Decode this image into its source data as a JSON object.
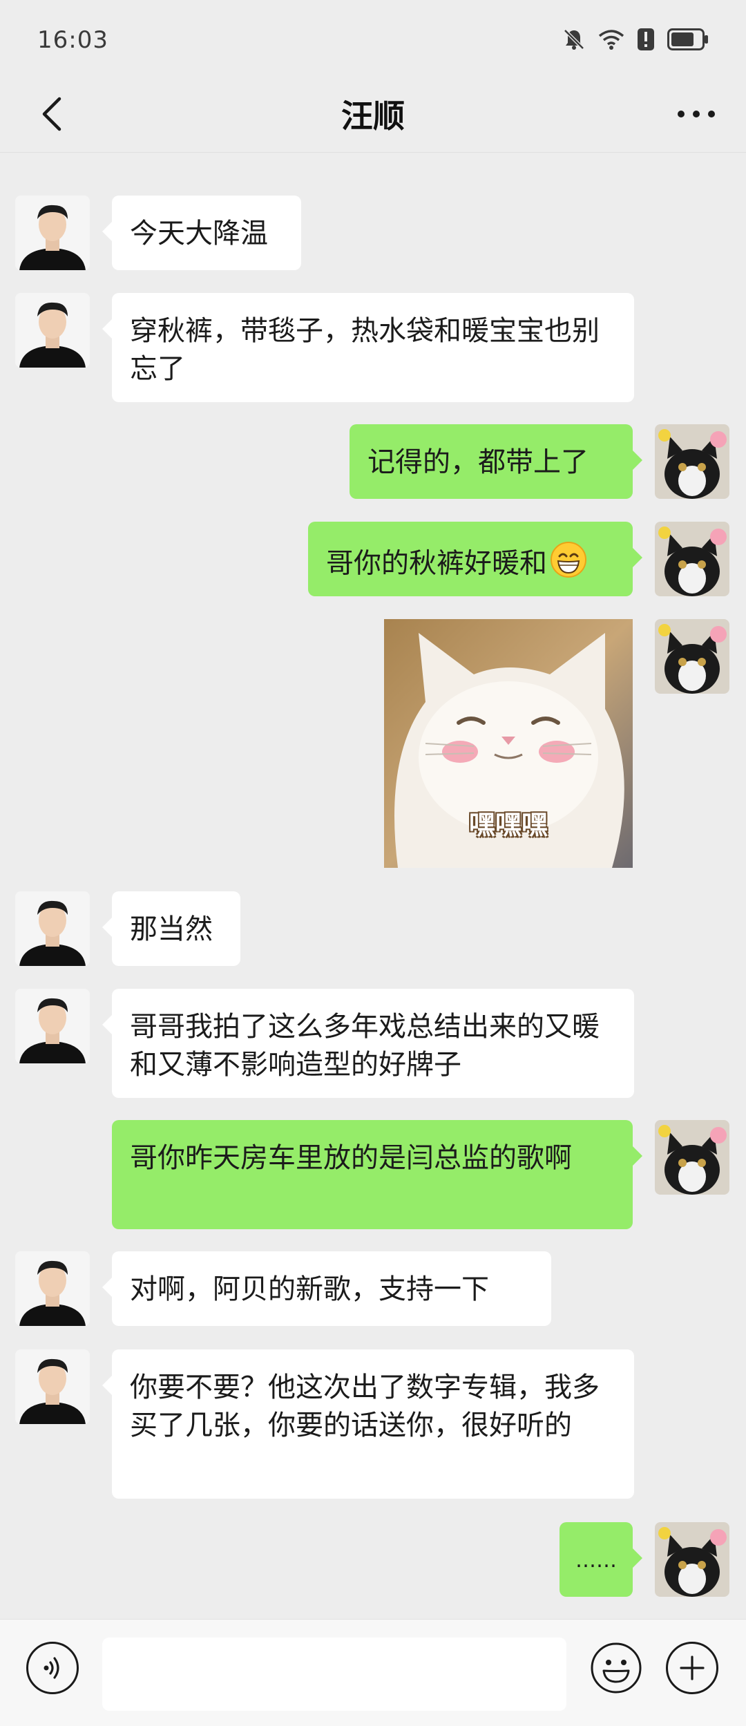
{
  "status_bar": {
    "time": "16:03",
    "icons": [
      "bell-off-icon",
      "wifi-icon",
      "alert-icon",
      "battery-icon"
    ]
  },
  "header": {
    "title": "汪顺",
    "back_icon": "chevron-left-icon",
    "more_icon": "more-dots-icon"
  },
  "messages": [
    {
      "sender": "friend",
      "text": "今天大降温"
    },
    {
      "sender": "friend",
      "text": "穿秋裤，带毯子，热水袋和暖宝宝也别忘了"
    },
    {
      "sender": "self",
      "text": "记得的，都带上了"
    },
    {
      "sender": "self",
      "text": "哥你的秋裤好暖和",
      "emoji": "grinning-face-emoji"
    },
    {
      "sender": "self",
      "type": "sticker",
      "sticker_caption": "嘿嘿嘿"
    },
    {
      "sender": "friend",
      "text": "那当然"
    },
    {
      "sender": "friend",
      "text": "哥哥我拍了这么多年戏总结出来的又暖和又薄不影响造型的好牌子"
    },
    {
      "sender": "self",
      "text": "哥你昨天房车里放的是闫总监的歌啊"
    },
    {
      "sender": "friend",
      "text": "对啊，阿贝的新歌，支持一下"
    },
    {
      "sender": "friend",
      "text": "你要不要？他这次出了数字专辑，我多买了几张，你要的话送你，很好听的"
    },
    {
      "sender": "self",
      "text": "……"
    }
  ],
  "input_bar": {
    "voice_icon": "voice-icon",
    "placeholder": "",
    "emoji_icon": "smiley-icon",
    "plus_icon": "plus-icon"
  },
  "colors": {
    "background": "#ededed",
    "self_bubble": "#95ec69",
    "friend_bubble": "#ffffff"
  }
}
